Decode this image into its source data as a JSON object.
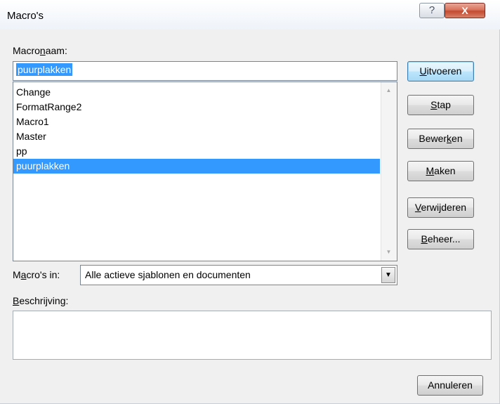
{
  "window": {
    "title": "Macro's",
    "help_label": "?",
    "close_label": "X"
  },
  "macro_name": {
    "label_pre": "Macro",
    "label_ul": "n",
    "label_post": "aam:",
    "value": "puurplakken"
  },
  "macro_list": {
    "items": [
      {
        "label": "Change",
        "selected": false
      },
      {
        "label": "FormatRange2",
        "selected": false
      },
      {
        "label": "Macro1",
        "selected": false
      },
      {
        "label": "Master",
        "selected": false
      },
      {
        "label": "pp",
        "selected": false
      },
      {
        "label": "puurplakken",
        "selected": true
      }
    ],
    "scroll_up_icon": "▲",
    "scroll_down_icon": "▼"
  },
  "buttons": {
    "run": {
      "ul": "U",
      "rest": "itvoeren"
    },
    "step": {
      "ul": "S",
      "rest": "tap"
    },
    "edit": {
      "pre": "Bewer",
      "ul": "k",
      "rest": "en"
    },
    "create": {
      "ul": "M",
      "rest": "aken"
    },
    "delete": {
      "ul": "V",
      "rest": "erwijderen"
    },
    "organizer": {
      "ul": "B",
      "rest": "eheer..."
    },
    "cancel": "Annuleren"
  },
  "macros_in": {
    "label_pre": "M",
    "label_ul": "a",
    "label_post": "cro's in:",
    "value": "Alle actieve sjablonen en documenten",
    "arrow_icon": "▼"
  },
  "description": {
    "label_ul": "B",
    "label_post": "eschrijving:",
    "value": ""
  },
  "colors": {
    "selection": "#3399ff",
    "close_button": "#c44a2f",
    "default_button_border": "#3c7fb1"
  }
}
